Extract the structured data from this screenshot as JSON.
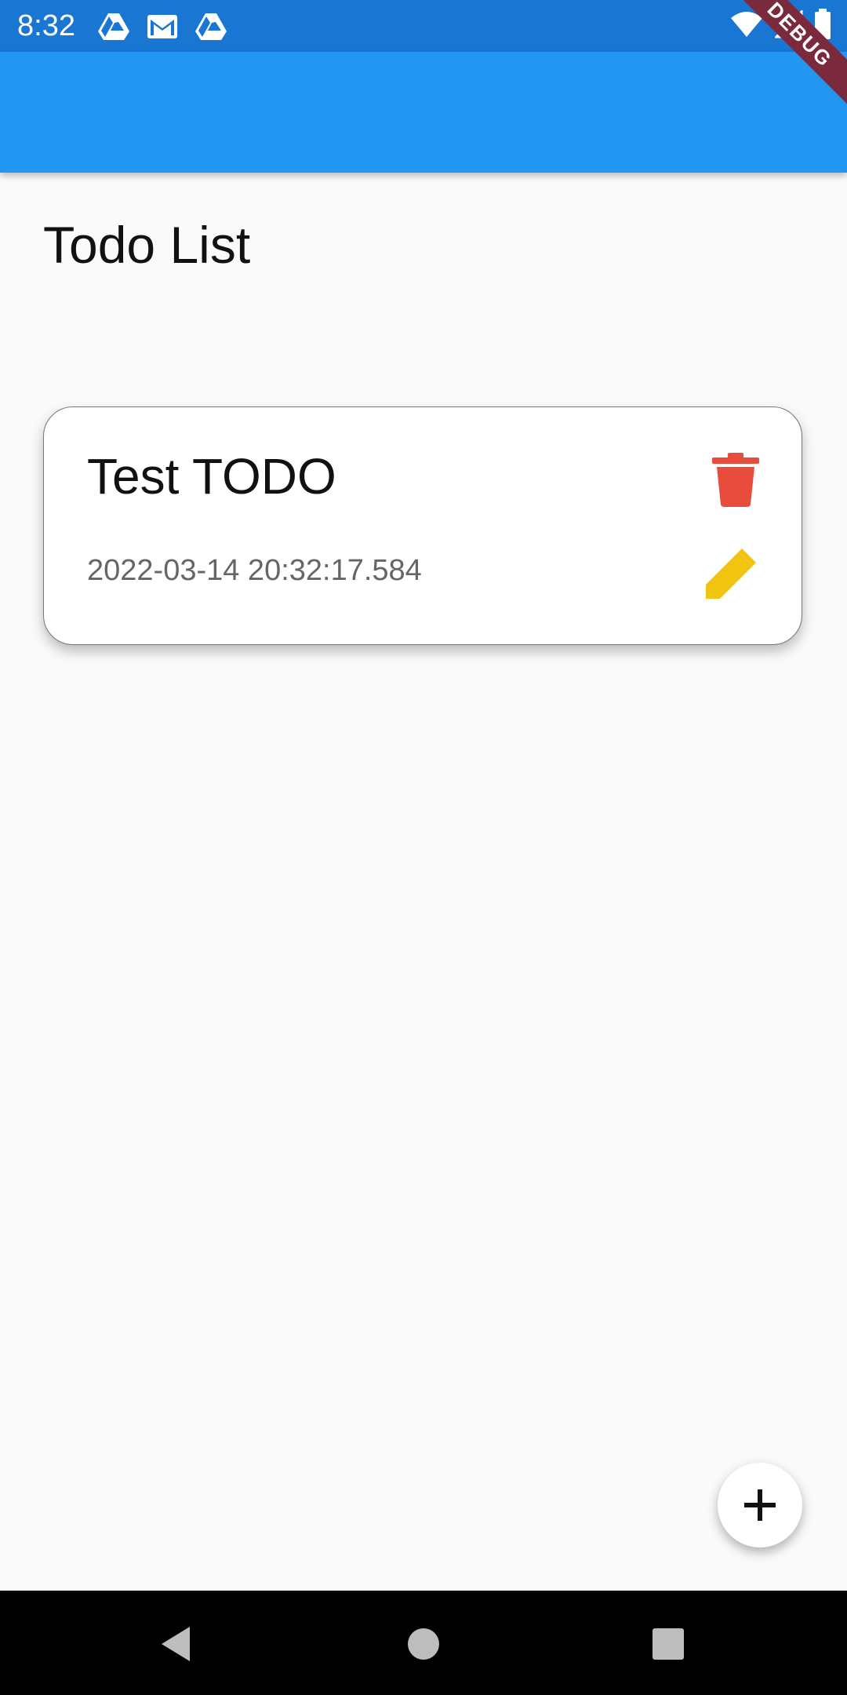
{
  "status_bar": {
    "time": "8:32",
    "left_icons": [
      "drive-icon",
      "gmail-icon",
      "drive-icon"
    ],
    "right_icons": [
      "wifi-icon",
      "signal-icon",
      "battery-icon"
    ],
    "background": "#1976d2"
  },
  "debug_banner": {
    "label": "DEBUG",
    "color": "#7b2a3e"
  },
  "app_bar": {
    "title": "",
    "color": "#2196f3"
  },
  "page": {
    "title": "Todo List"
  },
  "todos": [
    {
      "title": "Test TODO",
      "date": "2022-03-14 20:32:17.584",
      "delete_icon": "trash-icon",
      "edit_icon": "pencil-icon",
      "delete_color": "#e74c3c",
      "edit_color": "#f1c40f"
    }
  ],
  "fab": {
    "icon": "plus-icon"
  },
  "nav_bar": {
    "buttons": [
      "back-icon",
      "home-icon",
      "recents-icon"
    ]
  }
}
